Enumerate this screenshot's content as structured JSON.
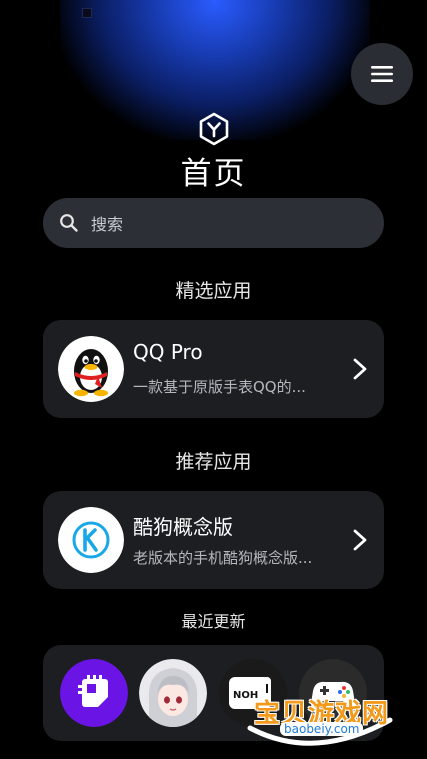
{
  "header": {
    "title": "首页",
    "menu_icon": "hamburger-menu-icon",
    "logo_icon": "hexagon-y-logo-icon"
  },
  "search": {
    "placeholder": "搜索",
    "icon": "search-icon"
  },
  "featured": {
    "section_title": "精选应用",
    "app": {
      "name": "QQ Pro",
      "description": "一款基于原版手表QQ的...",
      "icon": "qq-penguin-icon"
    }
  },
  "recommended": {
    "section_title": "推荐应用",
    "app": {
      "name": "酷狗概念版",
      "description": "老版本的手机酷狗概念版...",
      "icon": "kugou-k-icon"
    }
  },
  "recent": {
    "section_title": "最近更新",
    "icons": [
      "chip-app-icon",
      "anime-avatar-icon",
      "noh-app-icon",
      "gamepad-app-icon"
    ]
  },
  "watermark": {
    "text": "宝贝游戏网",
    "url": "baobeiy.com"
  },
  "colors": {
    "background": "#000000",
    "card": "#1c1e22",
    "accent_blue": "#2a5cff",
    "qq_red": "#e02020",
    "kugou_blue": "#1aa7e8",
    "recent_purple": "#6a14e6"
  }
}
